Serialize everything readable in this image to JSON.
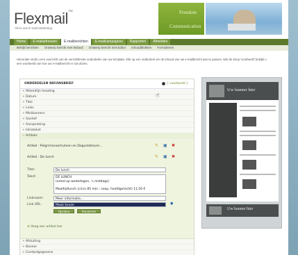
{
  "brand": {
    "logo_text": "Flexmail",
    "logo_mark": "™",
    "tagline": "All-in-one E-mail Marketing",
    "header_line1": "Freedom",
    "header_line2": "Communication"
  },
  "nav": {
    "tabs": [
      "Home",
      "E-mailadressen",
      "E-mailberichten",
      "E-mailcampagnes",
      "Rapporten",
      "Afmelden"
    ],
    "active": "E-mailberichten"
  },
  "subnav": [
    "Bekijk berichten",
    "Ontwerp bericht met Wizard",
    "Ontwerp bericht met Editor",
    "Inhoudblokken",
    "Formulieren"
  ],
  "intro": "Hieronder vindt u een overzicht van de verschillende onderdelen van uw template. Klik op een onderdeel om de inhoud van uw e-mailbericht aan te passen. Met de knop 'voorbeeld' bekijkt u een voorbeeld van hoe uw e-mailbericht er zal uitzien.",
  "panel": {
    "title": "ONDERDELEN NIEUWSBRIEF",
    "preview_link": "[ voorbeeld ]",
    "sections_before": [
      "Afzendlijn heading",
      "Datum",
      "Titel",
      "Links",
      "Minibanners",
      "Aanhef",
      "Aanspreking",
      "Introtekst"
    ],
    "open_section": "Artikels",
    "articles": [
      "Artikel : Pelgrimsvoertuimen en Degustatievel...",
      "Artikel : De lunch"
    ],
    "form": {
      "title_label": "Titel:",
      "title_value": "De lunch",
      "text_label": "Tekst:",
      "text_lines": [
        "DE LUNCH",
        "(enkel op weekdagen, 's middags)",
        "",
        "Maaltijdlunch (circa 85 min.: soep, hoofdgerecht) 11,50 €"
      ],
      "link_label": "Linknaam:",
      "link_value": "Meer informatie...",
      "url_label": "Link URL:",
      "url_value": "Maak keuze",
      "save_label": "Opslaan",
      "cancel_label": "Annuleren"
    },
    "add_article": "Voeg een artikel toe",
    "sections_after": [
      "Afsluiting",
      "Banner",
      "Contactgegevens"
    ]
  },
  "preview": {
    "top_banner": "Uw banner hier",
    "bottom_banner": "Uw banner hier"
  },
  "colors": {
    "accent": "#6e9a26",
    "nav": "#5d7a2c",
    "link": "#6a8a2a"
  }
}
